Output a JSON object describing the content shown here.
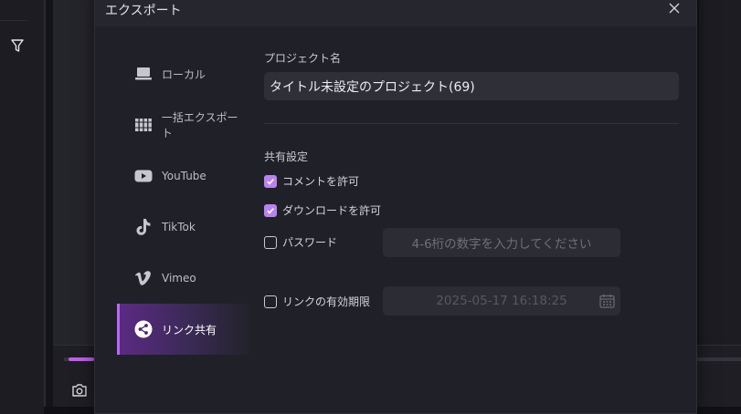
{
  "dialog": {
    "title": "エクスポート"
  },
  "sidebar": {
    "items": [
      {
        "label": "ローカル",
        "icon": "laptop-icon"
      },
      {
        "label": "一括エクスポート",
        "icon": "batch-export-icon"
      },
      {
        "label": "YouTube",
        "icon": "youtube-icon"
      },
      {
        "label": "TikTok",
        "icon": "tiktok-icon"
      },
      {
        "label": "Vimeo",
        "icon": "vimeo-icon"
      },
      {
        "label": "リンク共有",
        "icon": "share-icon",
        "active": true
      }
    ]
  },
  "project": {
    "label": "プロジェクト名",
    "value": "タイトル未設定のプロジェクト(69)"
  },
  "share_settings": {
    "heading": "共有設定",
    "allow_comments": {
      "label": "コメントを許可",
      "checked": true
    },
    "allow_download": {
      "label": "ダウンロードを許可",
      "checked": true
    },
    "password": {
      "label": "パスワード",
      "checked": false,
      "placeholder": "4-6桁の数字を入力してください"
    },
    "expiry": {
      "label": "リンクの有効期限",
      "checked": false,
      "value": "2025-05-17 16:18:25"
    }
  },
  "colors": {
    "accent": "#b983ee",
    "active_gradient_start": "#5d2a86",
    "dialog_bg": "#202028",
    "input_bg": "#2f2f37"
  }
}
